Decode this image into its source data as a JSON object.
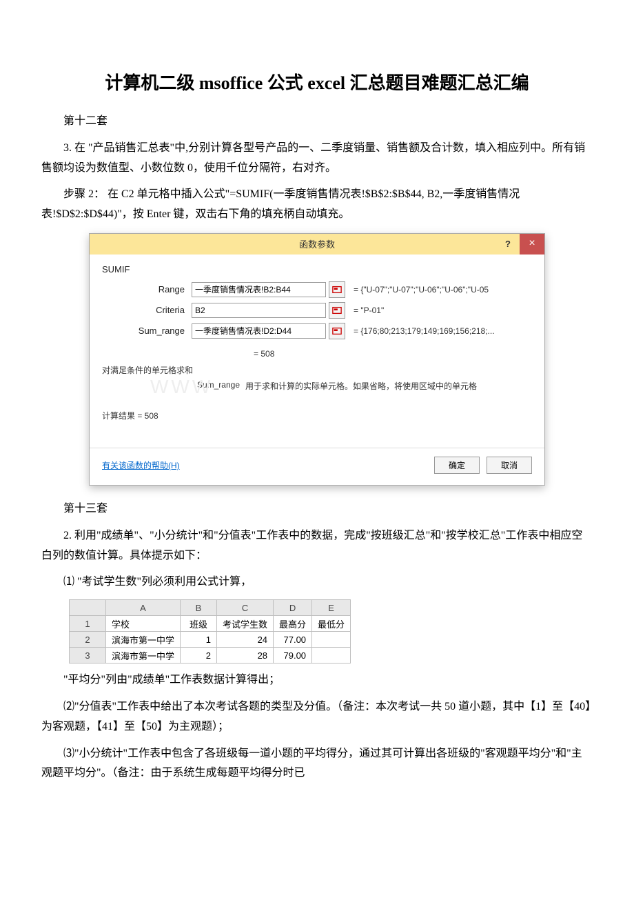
{
  "title": "计算机二级 msoffice 公式 excel 汇总题目难题汇总汇编",
  "section12": {
    "heading": "第十二套",
    "q3": "3. 在 \"产品销售汇总表\"中,分别计算各型号产品的一、二季度销量、销售额及合计数，填入相应列中。所有销售额均设为数值型、小数位数 0，使用千位分隔符，右对齐。",
    "step2": "步骤 2： 在 C2 单元格中插入公式\"=SUMIF(一季度销售情况表!$B$2:$B$44, B2,一季度销售情况表!$D$2:$D$44)\"，按 Enter 键，双击右下角的填充柄自动填充。"
  },
  "dialog": {
    "title": "函数参数",
    "funcName": "SUMIF",
    "args": {
      "rangeLabel": "Range",
      "rangeValue": "一季度销售情况表!B2:B44",
      "rangeEval": "=  {\"U-07\";\"U-07\";\"U-06\";\"U-06\";\"U-05",
      "criteriaLabel": "Criteria",
      "criteriaValue": "B2",
      "criteriaEval": "=  \"P-01\"",
      "sumRangeLabel": "Sum_range",
      "sumRangeValue": "一季度销售情况表!D2:D44",
      "sumRangeEval": "=  {176;80;213;179;149;169;156;218;..."
    },
    "resultLine": "=  508",
    "desc": "对满足条件的单元格求和",
    "paramName": "Sum_range",
    "paramText": "用于求和计算的实际单元格。如果省略，将使用区域中的单元格",
    "calcResult": "计算结果 =  508",
    "helpLink": "有关该函数的帮助(H)",
    "ok": "确定",
    "cancel": "取消"
  },
  "section13": {
    "heading": "第十三套",
    "q2": "2. 利用\"成绩单\"、\"小分统计\"和\"分值表\"工作表中的数据，完成\"按班级汇总\"和\"按学校汇总\"工作表中相应空白列的数值计算。具体提示如下：",
    "item1a": "⑴ \"考试学生数\"列必须利用公式计算，",
    "item1b": "\"平均分\"列由\"成绩单\"工作表数据计算得出；",
    "item2": "⑵\"分值表\"工作表中给出了本次考试各题的类型及分值。（备注：本次考试一共 50 道小题，其中【1】至【40】为客观题，【41】至【50】为主观题）；",
    "item3": "⑶\"小分统计\"工作表中包含了各班级每一道小题的平均得分，通过其可计算出各班级的\"客观题平均分\"和\"主观题平均分\"。（备注：由于系统生成每题平均得分时已"
  },
  "sheet": {
    "cols": [
      "",
      "A",
      "B",
      "C",
      "D",
      "E"
    ],
    "rows": [
      {
        "n": "1",
        "a": "学校",
        "b": "班级",
        "c": "考试学生数",
        "d": "最高分",
        "e": "最低分"
      },
      {
        "n": "2",
        "a": "滨海市第一中学",
        "b": "1",
        "c": "24",
        "d": "77.00",
        "e": ""
      },
      {
        "n": "3",
        "a": "滨海市第一中学",
        "b": "2",
        "c": "28",
        "d": "79.00",
        "e": ""
      }
    ]
  }
}
